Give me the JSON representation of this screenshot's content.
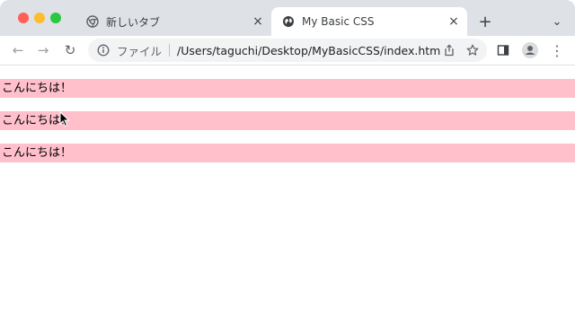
{
  "tabs": [
    {
      "title": "新しいタブ",
      "close": "×",
      "active": false,
      "favicon": "chrome-icon"
    },
    {
      "title": "My Basic CSS",
      "close": "×",
      "active": true,
      "favicon": "globe-icon"
    }
  ],
  "new_tab_label": "+",
  "tab_search_label": "⌄",
  "toolbar": {
    "back": "←",
    "forward": "→",
    "reload": "↻",
    "menu": "⋮"
  },
  "address_bar": {
    "scheme_label": "ファイル",
    "url": "/Users/taguchi/Desktop/MyBasicCSS/index.html"
  },
  "paragraphs": [
    {
      "text": "こんにちは！"
    },
    {
      "text": "こんにちは！"
    },
    {
      "text": "こんにちは！"
    }
  ],
  "colors": {
    "paragraph_background": "#ffc0cb",
    "tabstrip_background": "#dee1e6"
  }
}
